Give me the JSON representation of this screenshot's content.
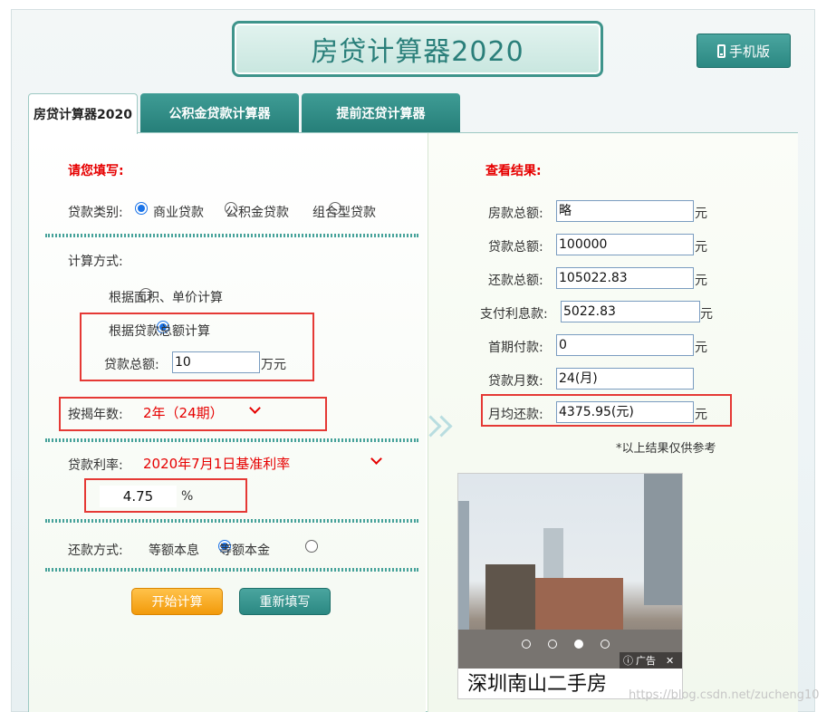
{
  "header": {
    "title": "房贷计算器2020",
    "mobile_label": "手机版"
  },
  "tabs": [
    "房贷计算器2020",
    "公积金贷款计算器",
    "提前还贷计算器"
  ],
  "form": {
    "heading": "请您填写:",
    "loan_type_label": "贷款类别:",
    "loan_types": [
      "商业贷款",
      "公积金贷款",
      "组合型贷款"
    ],
    "calc_method_label": "计算方式:",
    "calc_methods": [
      "根据面积、单价计算",
      "根据贷款总额计算"
    ],
    "loan_total_label": "贷款总额:",
    "loan_total_value": "10",
    "loan_total_unit": "万元",
    "years_label": "按揭年数:",
    "years_value": "2年（24期）",
    "rate_label": "贷款利率:",
    "rate_value": "2020年7月1日基准利率",
    "rate_percent": "4.75",
    "rate_unit": "%",
    "repay_label": "还款方式:",
    "repay_methods": [
      "等额本息",
      "等额本金"
    ],
    "start_button": "开始计算",
    "reset_button": "重新填写"
  },
  "results": {
    "heading": "查看结果:",
    "rows": [
      {
        "label": "房款总额:",
        "value": "略",
        "unit": "元"
      },
      {
        "label": "贷款总额:",
        "value": "100000",
        "unit": "元"
      },
      {
        "label": "还款总额:",
        "value": "105022.83",
        "unit": "元"
      },
      {
        "label": "支付利息款:",
        "value": "5022.83",
        "unit": "元"
      },
      {
        "label": "首期付款:",
        "value": "0",
        "unit": "元"
      },
      {
        "label": "贷款月数:",
        "value": "24(月)",
        "unit": ""
      },
      {
        "label": "月均还款:",
        "value": "4375.95(元)",
        "unit": "元"
      }
    ],
    "note": "*以上结果仅供参考"
  },
  "ad": {
    "badge": "广告",
    "caption": "深圳南山二手房"
  },
  "watermark": "https://blog.csdn.net/zucheng10"
}
